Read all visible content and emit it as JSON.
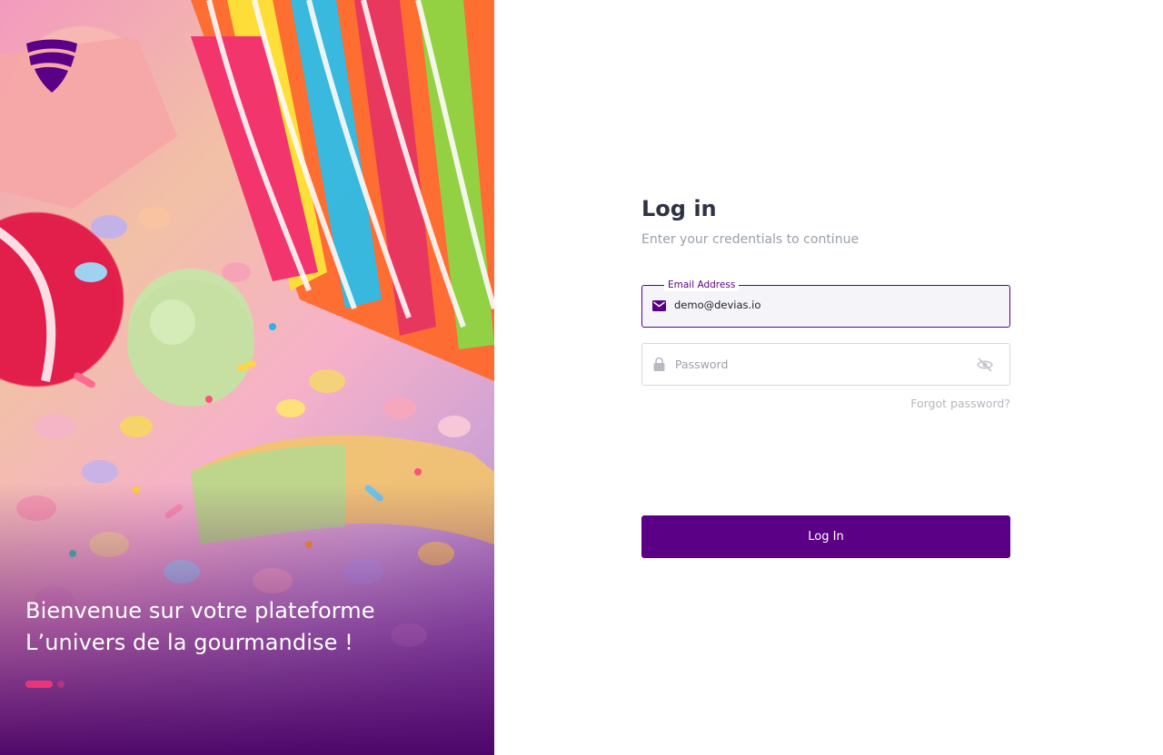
{
  "hero": {
    "line1": "Bienvenue sur votre plateforme",
    "line2": "L’univers de la gourmandise !",
    "slides_total": 2,
    "slide_active": 1
  },
  "brand": {
    "logo_icon": "shield-logo-icon",
    "accent_color": "#5b0086",
    "pink_color": "#e8357a"
  },
  "login": {
    "title": "Log in",
    "subtitle": "Enter your credentials to continue",
    "email": {
      "label": "Email Address",
      "value": "demo@devias.io",
      "icon": "mail-icon"
    },
    "password": {
      "placeholder": "Password",
      "icon": "lock-icon",
      "toggle_icon": "eye-off-icon"
    },
    "forgot_label": "Forgot password?",
    "submit_label": "Log In"
  }
}
